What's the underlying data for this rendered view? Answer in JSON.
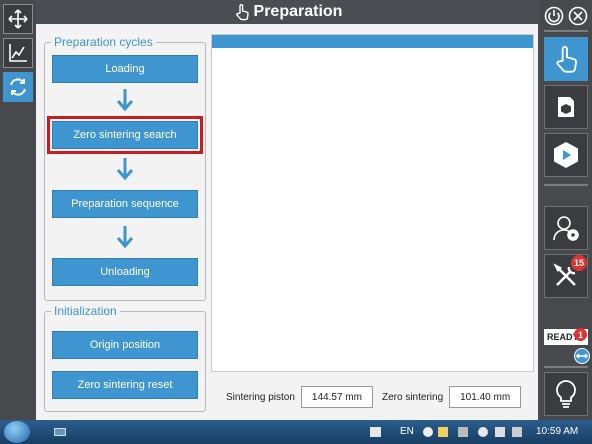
{
  "window": {
    "title": "Preparation"
  },
  "left_toolbar": [
    {
      "icon": "move-arrows-icon",
      "active": false
    },
    {
      "icon": "chart-icon",
      "active": false
    },
    {
      "icon": "cycle-icon",
      "active": true
    }
  ],
  "preparation_cycles": {
    "legend": "Preparation cycles",
    "buttons": [
      "Loading",
      "Zero sintering search",
      "Preparation sequence",
      "Unloading"
    ],
    "selected": "Zero sintering search"
  },
  "initialization": {
    "legend": "Initialization",
    "buttons": [
      "Origin position",
      "Zero sintering reset"
    ]
  },
  "readouts": {
    "sintering_piston": {
      "label": "Sintering piston",
      "value": "144.57 mm"
    },
    "zero_sintering": {
      "label": "Zero sintering",
      "value": "101.40 mm"
    }
  },
  "right_toolbar": {
    "items": [
      "hand-pointer-icon",
      "package-icon",
      "play-cube-icon",
      "user-settings-icon",
      "tools-icon",
      "lightbulb-icon"
    ],
    "tools_badge": "15",
    "status": "READY",
    "status_badge": "1"
  },
  "taskbar": {
    "language": "EN",
    "time": "10:59 AM"
  },
  "colors": {
    "accent": "#3f95cf",
    "highlight": "#c41e1e",
    "panel": "#f3f3f3",
    "chrome": "#4a4d52"
  }
}
